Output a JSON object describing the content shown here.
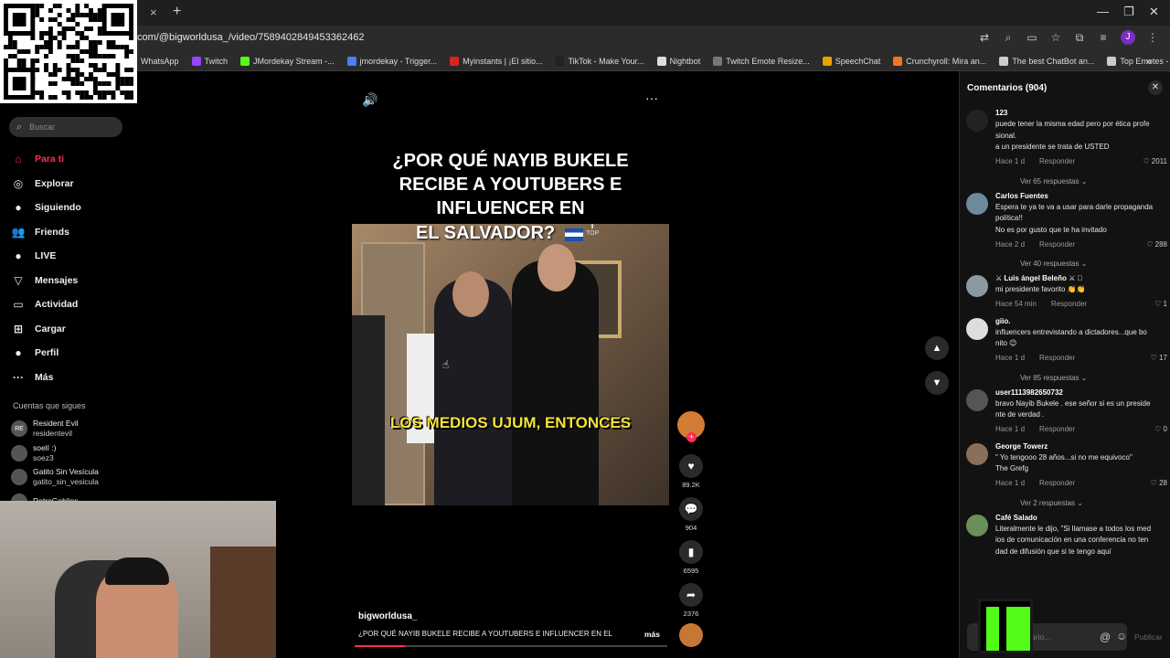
{
  "browser": {
    "tab_close": "×",
    "new_tab": "+",
    "url": "com/@bigworldusa_/video/7589402849453362462",
    "window_controls": [
      "—",
      "❐",
      "✕"
    ],
    "profile_initial": "J",
    "bookmarks": [
      {
        "label": "WhatsApp",
        "color": "#25d366"
      },
      {
        "label": "Twitch",
        "color": "#9146ff"
      },
      {
        "label": "JMordekay Stream -...",
        "color": "#53fc18"
      },
      {
        "label": "jmordekay - Trigger...",
        "color": "#4a7dff"
      },
      {
        "label": "Myinstants | ¡El sitio...",
        "color": "#d22"
      },
      {
        "label": "TikTok - Make Your...",
        "color": "#222"
      },
      {
        "label": "Nightbot",
        "color": "#ddd"
      },
      {
        "label": "Twitch Emote Resize...",
        "color": "#777"
      },
      {
        "label": "SpeechChat",
        "color": "#e8a200"
      },
      {
        "label": "Crunchyroll: Mira an...",
        "color": "#f47521"
      },
      {
        "label": "The best ChatBot an...",
        "color": "#ccc"
      },
      {
        "label": "Top Emotes - 7TV",
        "color": "#ccc"
      }
    ],
    "bookmarks_more": "»"
  },
  "sidebar": {
    "search_placeholder": "Buscar",
    "nav": [
      {
        "label": "Para ti",
        "icon": "home-icon",
        "glyph": "⌂",
        "active": true
      },
      {
        "label": "Explorar",
        "icon": "compass-icon",
        "glyph": "◎"
      },
      {
        "label": "Siguiendo",
        "icon": "following-icon",
        "glyph": "●"
      },
      {
        "label": "Friends",
        "icon": "friends-icon",
        "glyph": "👥"
      },
      {
        "label": "LIVE",
        "icon": "live-icon",
        "glyph": "●"
      },
      {
        "label": "Mensajes",
        "icon": "messages-icon",
        "glyph": "▽"
      },
      {
        "label": "Actividad",
        "icon": "activity-icon",
        "glyph": "▭"
      },
      {
        "label": "Cargar",
        "icon": "upload-icon",
        "glyph": "⊞"
      },
      {
        "label": "Perfil",
        "icon": "profile-icon",
        "glyph": "●"
      },
      {
        "label": "Más",
        "icon": "more-icon",
        "glyph": "···"
      }
    ],
    "following_title": "Cuentas que sigues",
    "following": [
      {
        "name": "Resident Evil",
        "user": "residentevil",
        "avatar": "RE"
      },
      {
        "name": "soelí :)",
        "user": "soez3",
        "avatar": ""
      },
      {
        "name": "Gatito Sin Vesícula",
        "user": "gatito_sin_vesicula",
        "avatar": ""
      },
      {
        "name": "RetroGoblins",
        "user": "",
        "avatar": ""
      }
    ]
  },
  "video": {
    "title_lines": [
      "¿POR QUÉ NAYIB BUKELE",
      "RECIBE A YOUTUBERS E",
      "INFLUENCER EN"
    ],
    "title_line4": "EL SALVADOR?",
    "top_mark": "TOP",
    "caption": "LOS MEDIOS UJUM, ENTONCES",
    "author": "bigworldusa_",
    "description": "¿POR QUÉ NAYIB BUKELE RECIBE A YOUTUBERS E INFLUENCER EN EL",
    "more": "más",
    "progress": 0.16
  },
  "actions": {
    "plus": "+",
    "likes": "89.2K",
    "comments": "904",
    "saves": "6595",
    "shares": "2376"
  },
  "comments": {
    "header": "Comentarios (904)",
    "close": "✕",
    "input_placeholder": "ario...",
    "publish": "Publicar",
    "items": [
      {
        "name": "123",
        "text": [
          "puede tener la misma edad pero por ética profe",
          "sional.",
          "a un presidente se trata de USTED"
        ],
        "time": "Hace 1 d",
        "reply": "Responder",
        "likes": "2011",
        "replies": "Ver 65 respuestas ⌄",
        "avatar_color": "#222"
      },
      {
        "name": "Carlos Fuentes",
        "text": [
          "Espera te ya te va a usar para darle propaganda",
          "política!!",
          "No es por gusto que te ha invitado"
        ],
        "time": "Hace 2 d",
        "reply": "Responder",
        "likes": "288",
        "replies": "Ver 40 respuestas ⌄",
        "avatar_color": "#6c8a9a"
      },
      {
        "name": "⚔ Luis ángel Beleño ⚔ 🏻",
        "text": [
          "mi presidente favorito 👏👏"
        ],
        "time": "Hace 54 min",
        "reply": "Responder",
        "likes": "1",
        "replies": "",
        "avatar_color": "#8a9aa0"
      },
      {
        "name": "giio.",
        "text": [
          "influencers entrevistando a dictadores...que bo",
          "nito 😉"
        ],
        "time": "Hace 1 d",
        "reply": "Responder",
        "likes": "17",
        "replies": "Ver 85 respuestas ⌄",
        "avatar_color": "#ddd"
      },
      {
        "name": "user1113982650732",
        "text": [
          "bravo Nayib Bukele . ese señor si es un preside",
          "nte de verdad ."
        ],
        "time": "Hace 1 d",
        "reply": "Responder",
        "likes": "0",
        "replies": "",
        "avatar_color": "#555"
      },
      {
        "name": "George Towerz",
        "text": [
          "\" Yo tengooo 28 años...si no me equivoco\"",
          "The Grefg"
        ],
        "time": "Hace 1 d",
        "reply": "Responder",
        "likes": "28",
        "replies": "Ver 2 respuestas ⌄",
        "avatar_color": "#8a6f5a"
      },
      {
        "name": "Café Salado",
        "text": [
          "Literalmente le dijo, \"Si llamase a todos los med",
          "ios de comunicación en una conferencia no ten",
          "dad de difusión que si te tengo aquí"
        ],
        "time": "",
        "reply": "",
        "likes": "",
        "replies": "",
        "avatar_color": "#6a8f5a"
      }
    ]
  }
}
